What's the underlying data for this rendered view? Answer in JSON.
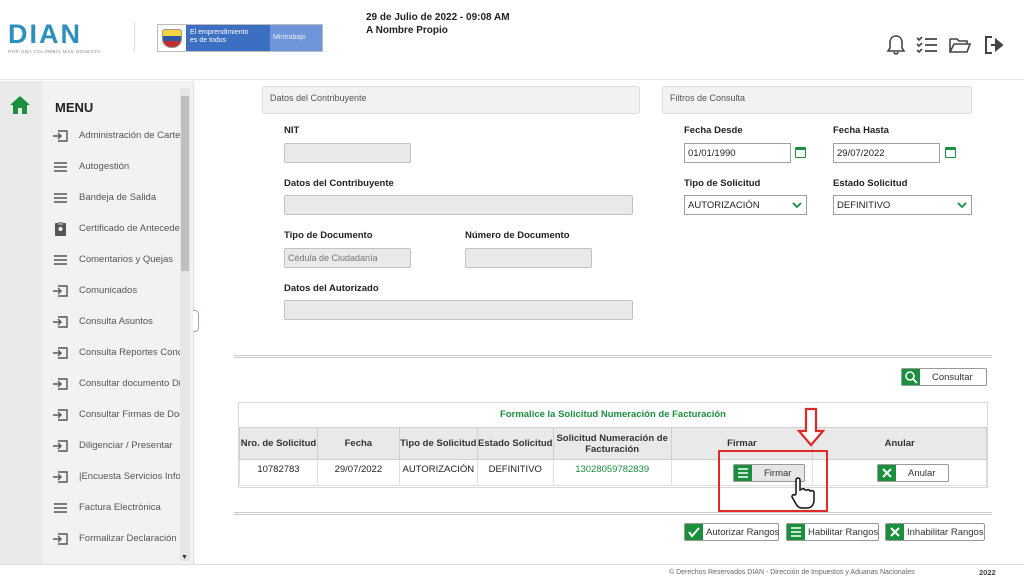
{
  "header": {
    "logo_text": "DIAN",
    "logo_tagline": "POR UNA COLOMBIA MÁS HONESTA",
    "gov_line1": "El emprendimiento",
    "gov_line2": "es de todos",
    "gov_line3": "Mintrabajo",
    "datetime": "29 de Julio de 2022 - 09:08 AM",
    "user_mode": "A Nombre Propio",
    "icons": [
      "bell-icon",
      "tasks-icon",
      "folder-open-icon",
      "logout-icon"
    ]
  },
  "sidebar": {
    "title": "MENU",
    "items": [
      {
        "label": "Administración de Cartera",
        "icon": "arrow-in-box-icon"
      },
      {
        "label": "Autogestión",
        "icon": "hamburger-icon"
      },
      {
        "label": "Bandeja de Salida",
        "icon": "hamburger-icon"
      },
      {
        "label": "Certificado de Antecedentes",
        "icon": "badge-icon"
      },
      {
        "label": "Comentarios y Quejas",
        "icon": "hamburger-icon"
      },
      {
        "label": "Comunicados",
        "icon": "arrow-in-box-icon"
      },
      {
        "label": "Consulta Asuntos",
        "icon": "arrow-in-box-icon"
      },
      {
        "label": "Consulta Reportes Conciliación",
        "icon": "arrow-in-box-icon"
      },
      {
        "label": "Consultar documento Diligenciado",
        "icon": "arrow-in-box-icon"
      },
      {
        "label": "Consultar Firmas de Documentos",
        "icon": "arrow-in-box-icon"
      },
      {
        "label": "Diligenciar / Presentar",
        "icon": "arrow-in-box-icon"
      },
      {
        "label": "|Encuesta Servicios Informáticos",
        "icon": "arrow-in-box-icon"
      },
      {
        "label": "Factura Electrónica",
        "icon": "hamburger-icon"
      },
      {
        "label": "Formalizar Declaración Inicial",
        "icon": "arrow-in-box-icon"
      }
    ]
  },
  "contribuyente": {
    "panel_title": "Datos del Contribuyente",
    "nit_label": "NIT",
    "nit_value": "",
    "datos_label": "Datos del Contribuyente",
    "datos_value": "",
    "tipo_doc_label": "Tipo de Documento",
    "tipo_doc_value": "Cédula de Ciudadanía",
    "num_doc_label": "Número de Documento",
    "num_doc_value": "",
    "autorizado_label": "Datos del Autorizado",
    "autorizado_value": ""
  },
  "filtros": {
    "panel_title": "Filtros de Consulta",
    "fecha_desde_label": "Fecha Desde",
    "fecha_desde": "01/01/1990",
    "fecha_hasta_label": "Fecha Hasta",
    "fecha_hasta": "29/07/2022",
    "tipo_solicitud_label": "Tipo de Solicitud",
    "tipo_solicitud": "AUTORIZACIÓN",
    "estado_label": "Estado Solicitud",
    "estado": "DEFINITIVO"
  },
  "consultar_label": "Consultar",
  "table": {
    "title": "Formalice la Solicitud Numeración de Facturación",
    "headers": [
      "Nro. de Solicitud",
      "Fecha",
      "Tipo de Solicitud",
      "Estado Solicitud",
      "Solicitud Numeración de Facturación",
      "Firmar",
      "Anular"
    ],
    "rows": [
      {
        "nro": "10782783",
        "fecha": "29/07/2022",
        "tipo": "AUTORIZACIÓN",
        "estado": "DEFINITIVO",
        "solicitud": "13028059782839",
        "firmar": "Firmar",
        "anular": "Anular"
      }
    ]
  },
  "actions": {
    "autorizar": "Autorizar Rangos",
    "habilitar": "Habilitar Rangos",
    "inhabilitar": "Inhabilitar Rangos"
  },
  "footer": {
    "copyright": "© Derechos Reservados DIAN - Dirección de Impuestos y Aduanas Nacionales",
    "year": "2022"
  },
  "colors": {
    "accent": "#1a8f3e",
    "highlight": "#e02a2a",
    "brand": "#2d8fbc"
  }
}
